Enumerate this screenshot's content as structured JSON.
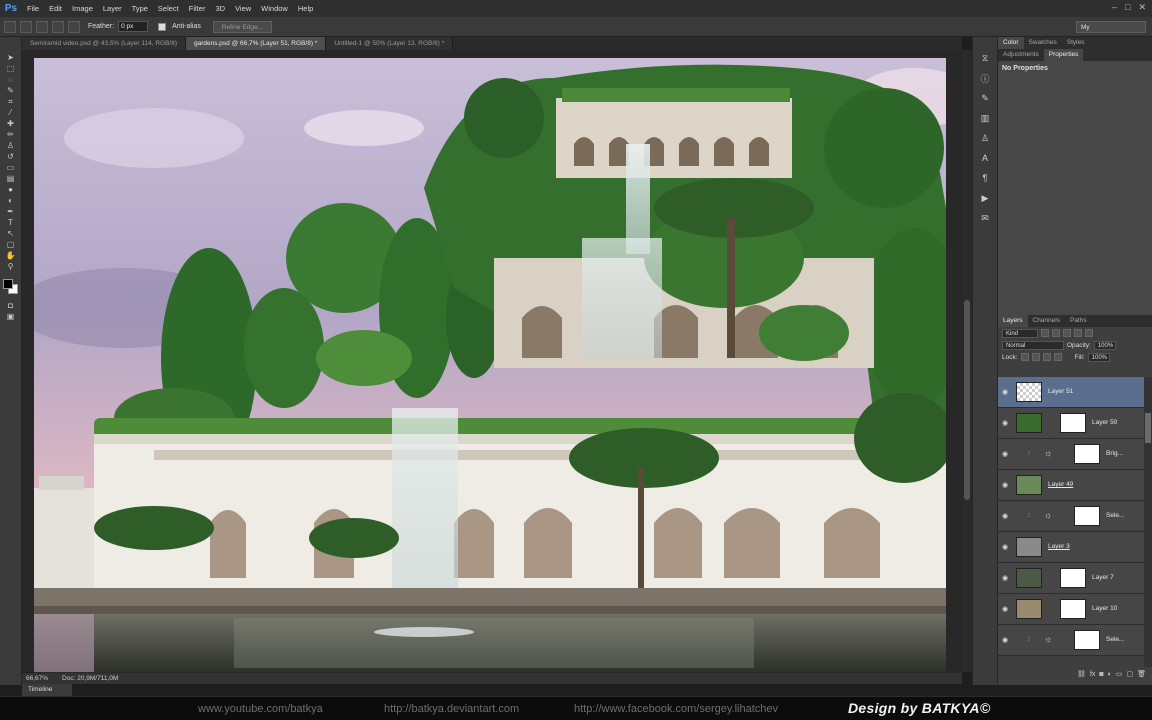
{
  "app": {
    "logo": "Ps"
  },
  "menu": [
    "File",
    "Edit",
    "Image",
    "Layer",
    "Type",
    "Select",
    "Filter",
    "3D",
    "View",
    "Window",
    "Help"
  ],
  "window_controls": [
    "–",
    "□",
    "✕"
  ],
  "options": {
    "feather_label": "Feather:",
    "feather_value": "0 px",
    "antialias_label": "Anti-alias",
    "refine_edge_label": "Refine Edge...",
    "workspace": "My"
  },
  "tabs": [
    {
      "label": "Semiramid video.psd @ 43,5% (Layer 114, RGB/8)",
      "active": false
    },
    {
      "label": "gardens.psd @ 66,7% (Layer 51, RGB/8) *",
      "active": true
    },
    {
      "label": "Untitled-1 @ 50% (Layer 13, RGB/8) *",
      "active": false
    }
  ],
  "status": {
    "zoom": "66,67%",
    "doc": "Doc: 20,9M/711,0M"
  },
  "timeline_label": "Timeline",
  "footer": {
    "youtube": "www.youtube.com/batkya",
    "deviantart": "http://batkya.deviantart.com",
    "facebook": "http://www.facebook.com/sergey.lihatchev",
    "credit": "Design by BATKYA©"
  },
  "panels": {
    "top_tabs": [
      "Color",
      "Swatches",
      "Styles"
    ],
    "mid_tabs": [
      "Adjustments",
      "Properties"
    ],
    "properties_title": "No Properties",
    "layers_tabs": [
      "Layers",
      "Channels",
      "Paths"
    ],
    "kind_label": "Kind",
    "blend_mode": "Normal",
    "opacity_label": "Opacity:",
    "opacity_value": "100%",
    "lock_label": "Lock:",
    "fill_label": "Fill:",
    "fill_value": "100%"
  },
  "layers": [
    {
      "name": "Layer 51",
      "selected": true,
      "thumb": "checker",
      "mask": false,
      "underline": false
    },
    {
      "name": "Layer 50",
      "selected": false,
      "thumb": "foliage",
      "mask": true,
      "underline": false
    },
    {
      "name": "Brig...",
      "selected": false,
      "thumb": "adjust",
      "mask": true,
      "underline": false
    },
    {
      "name": "Layer 49",
      "selected": false,
      "thumb": "palm",
      "mask": false,
      "underline": true
    },
    {
      "name": "Sele...",
      "selected": false,
      "thumb": "adjust",
      "mask": true,
      "underline": false
    },
    {
      "name": "Layer 3",
      "selected": false,
      "thumb": "strip",
      "mask": false,
      "underline": true
    },
    {
      "name": "Layer 7",
      "selected": false,
      "thumb": "scene",
      "mask": true,
      "underline": false
    },
    {
      "name": "Layer 10",
      "selected": false,
      "thumb": "wall",
      "mask": true,
      "underline": false
    },
    {
      "name": "Sele...",
      "selected": false,
      "thumb": "adjust",
      "mask": true,
      "underline": false
    }
  ],
  "colors": {
    "selected_layer": "#5a6f8e",
    "ps_blue": "#4aa4ff"
  }
}
